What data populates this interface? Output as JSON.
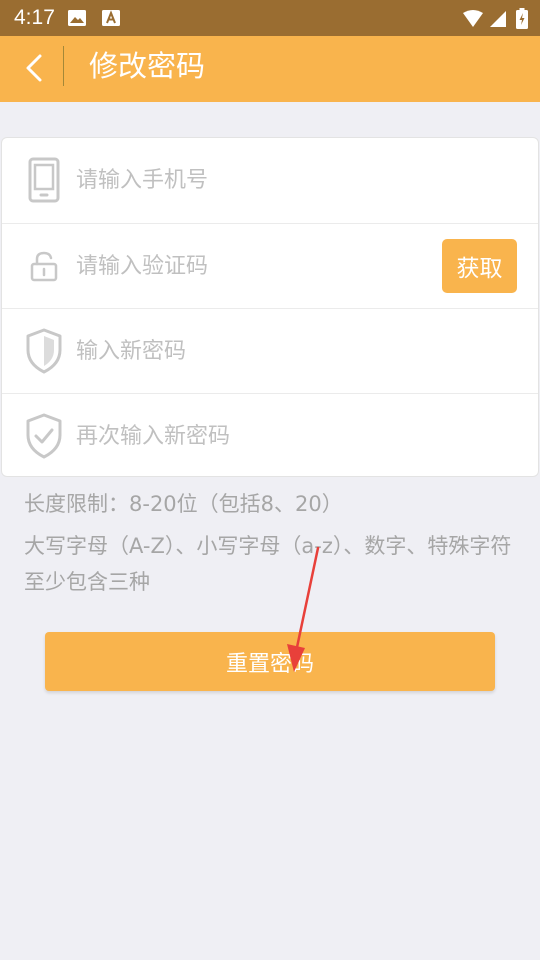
{
  "status_bar": {
    "time": "4:17",
    "icons": [
      "image-icon",
      "font-icon",
      "wifi-icon",
      "signal-icon",
      "battery-icon"
    ]
  },
  "header": {
    "title": "修改密码",
    "back_icon": "chevron-left-icon"
  },
  "form": {
    "phone_placeholder": "请输入手机号",
    "code_placeholder": "请输入验证码",
    "get_code_label": "获取",
    "new_password_placeholder": "输入新密码",
    "confirm_password_placeholder": "再次输入新密码"
  },
  "hints": {
    "length": "长度限制：8-20位（包括8、20）",
    "complexity": "大写字母（A-Z）、小写字母（a-z）、数字、特殊字符至少包含三种"
  },
  "reset_button": {
    "label": "重置密码"
  },
  "colors": {
    "status_bar": "#9a6d31",
    "accent": "#f9b44d",
    "background": "#efeff4",
    "placeholder": "#c0c0c0",
    "hint": "#a6a6a6",
    "annotation": "#e8403a"
  }
}
